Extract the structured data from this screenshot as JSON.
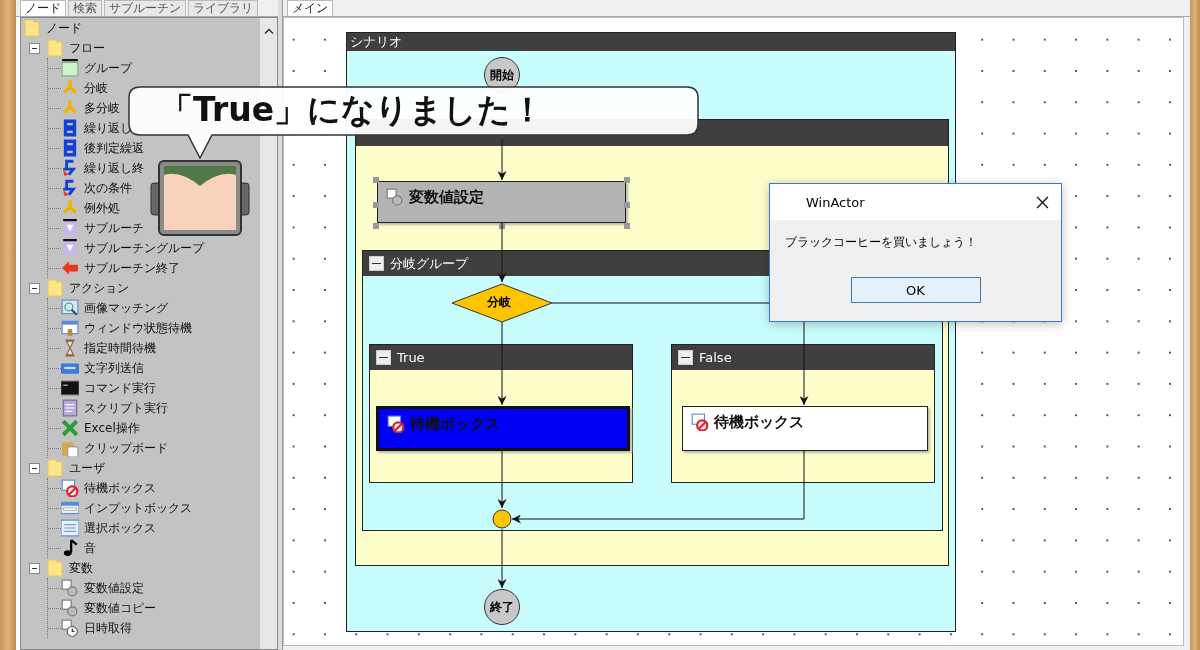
{
  "left_tabs": [
    {
      "label": "ノード",
      "selected": true
    },
    {
      "label": "検索",
      "selected": false
    },
    {
      "label": "サブルーチン",
      "selected": false
    },
    {
      "label": "ライブラリ",
      "selected": false
    }
  ],
  "tree": [
    {
      "label": "ノード",
      "children": [
        {
          "label": "フロー",
          "expanded": true,
          "children": [
            {
              "label": "グループ"
            },
            {
              "label": "分岐"
            },
            {
              "label": "多分岐"
            },
            {
              "label": "繰り返し"
            },
            {
              "label": "後判定繰返"
            },
            {
              "label": "繰り返し終"
            },
            {
              "label": "次の条件"
            },
            {
              "label": "例外処"
            },
            {
              "label": "サブルーチ"
            },
            {
              "label": "サブルーチングループ"
            },
            {
              "label": "サブルーチン終了"
            }
          ]
        },
        {
          "label": "アクション",
          "expanded": true,
          "children": [
            {
              "label": "画像マッチング"
            },
            {
              "label": "ウィンドウ状態待機"
            },
            {
              "label": "指定時間待機"
            },
            {
              "label": "文字列送信"
            },
            {
              "label": "コマンド実行"
            },
            {
              "label": "スクリプト実行"
            },
            {
              "label": "Excel操作"
            },
            {
              "label": "クリップボード"
            }
          ]
        },
        {
          "label": "ユーザ",
          "expanded": true,
          "children": [
            {
              "label": "待機ボックス"
            },
            {
              "label": "インプットボックス"
            },
            {
              "label": "選択ボックス"
            },
            {
              "label": "音"
            }
          ]
        },
        {
          "label": "変数",
          "expanded": true,
          "children": [
            {
              "label": "変数値設定"
            },
            {
              "label": "変数値コピー"
            },
            {
              "label": "日時取得"
            }
          ]
        }
      ]
    }
  ],
  "main_tabs": [
    {
      "label": "メイン",
      "selected": true
    }
  ],
  "diagram": {
    "scenario_title": "シナリオ",
    "start": "開始",
    "end": "終了",
    "set_node": {
      "label": "変数値設定",
      "selected": true
    },
    "branch_group": {
      "title": "分岐グループ",
      "expanded": true
    },
    "decision": "分岐",
    "branches": [
      {
        "title": "True",
        "expanded": true,
        "node": {
          "label": "待機ボックス",
          "active": true
        }
      },
      {
        "title": "False",
        "expanded": true,
        "node": {
          "label": "待機ボックス",
          "active": false
        }
      }
    ]
  },
  "dialog": {
    "title": "WinActor",
    "message": "ブラックコーヒーを買いましょう！",
    "button": "OK"
  },
  "callout": {
    "text": "「True」になりました！"
  }
}
